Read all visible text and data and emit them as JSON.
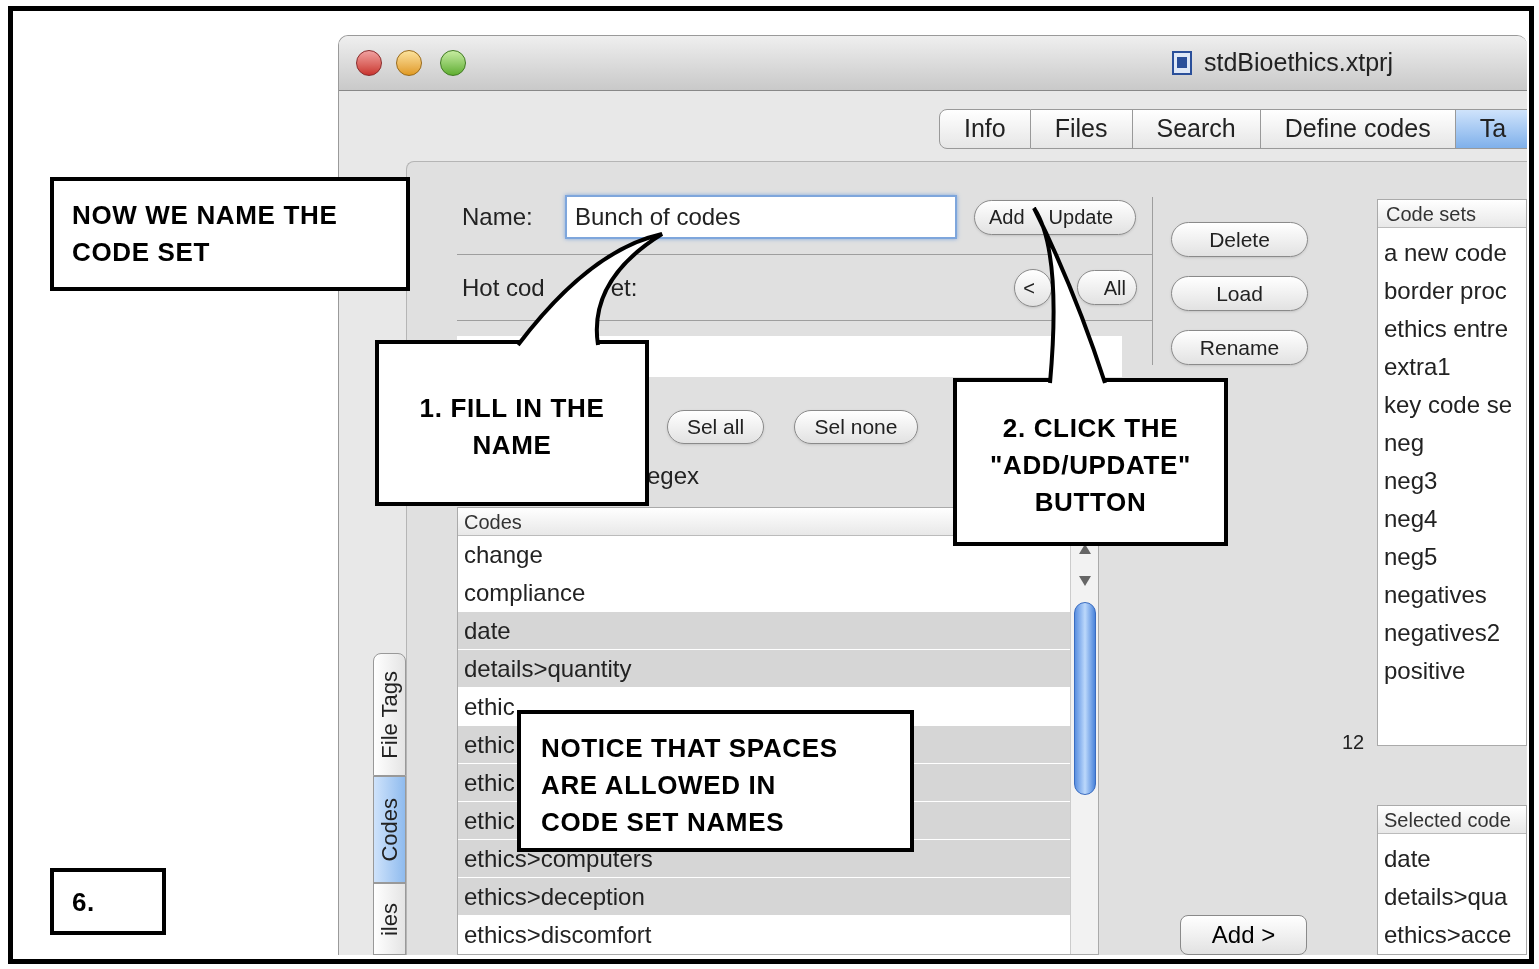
{
  "annotations": {
    "heading": "NOW WE NAME THE CODE SET",
    "step_1": "1. FILL IN THE NAME",
    "step_2": "2. CLICK THE \"ADD/UPDATE\" BUTTON",
    "notice": "NOTICE THAT SPACES ARE ALLOWED IN CODE SET NAMES",
    "slide_number": "6."
  },
  "window": {
    "title": "stdBioethics.xtprj"
  },
  "tabs": [
    {
      "label": "Info",
      "selected": false
    },
    {
      "label": "Files",
      "selected": false
    },
    {
      "label": "Search",
      "selected": false
    },
    {
      "label": "Define codes",
      "selected": false
    },
    {
      "label": "Ta",
      "selected": true
    }
  ],
  "side_tabs": [
    {
      "label": "File Tags",
      "selected": false
    },
    {
      "label": "Codes",
      "selected": true
    },
    {
      "label": "iles",
      "selected": false
    }
  ],
  "name_field": {
    "label": "Name:",
    "value": "Bunch of codes"
  },
  "add_update_button": {
    "label_parts": [
      "Add",
      "Update"
    ]
  },
  "hot_code_set": {
    "label_parts": [
      "Hot cod",
      "et:"
    ],
    "buttons": [
      "<",
      "All"
    ]
  },
  "selection_buttons": [
    "Sel all",
    "Sel none"
  ],
  "regex_label": "egex",
  "codes_list": {
    "header": "Codes",
    "rows": [
      {
        "label": "change",
        "selected": false
      },
      {
        "label": "compliance",
        "selected": false
      },
      {
        "label": "date",
        "selected": true
      },
      {
        "label": "details>quantity",
        "selected": true
      },
      {
        "label": "ethic",
        "selected": false
      },
      {
        "label": "ethic",
        "selected": true
      },
      {
        "label": "ethic",
        "selected": true
      },
      {
        "label": "ethic",
        "selected": true
      },
      {
        "label": "ethics>computers",
        "selected": true
      },
      {
        "label": "ethics>deception",
        "selected": true
      },
      {
        "label": "ethics>discomfort",
        "selected": false
      }
    ]
  },
  "action_buttons": [
    "Delete",
    "Load",
    "Rename"
  ],
  "code_sets": {
    "header": "Code sets",
    "count": "12",
    "rows": [
      "a new code",
      "border proc",
      "ethics entre",
      "extra1",
      "key code se",
      "neg",
      "neg3",
      "neg4",
      "neg5",
      "negatives",
      "negatives2",
      "positive"
    ]
  },
  "selected_codes": {
    "header": "Selected code",
    "rows": [
      "date",
      "details>qua",
      "ethics>acce"
    ]
  },
  "add_button": "Add >"
}
